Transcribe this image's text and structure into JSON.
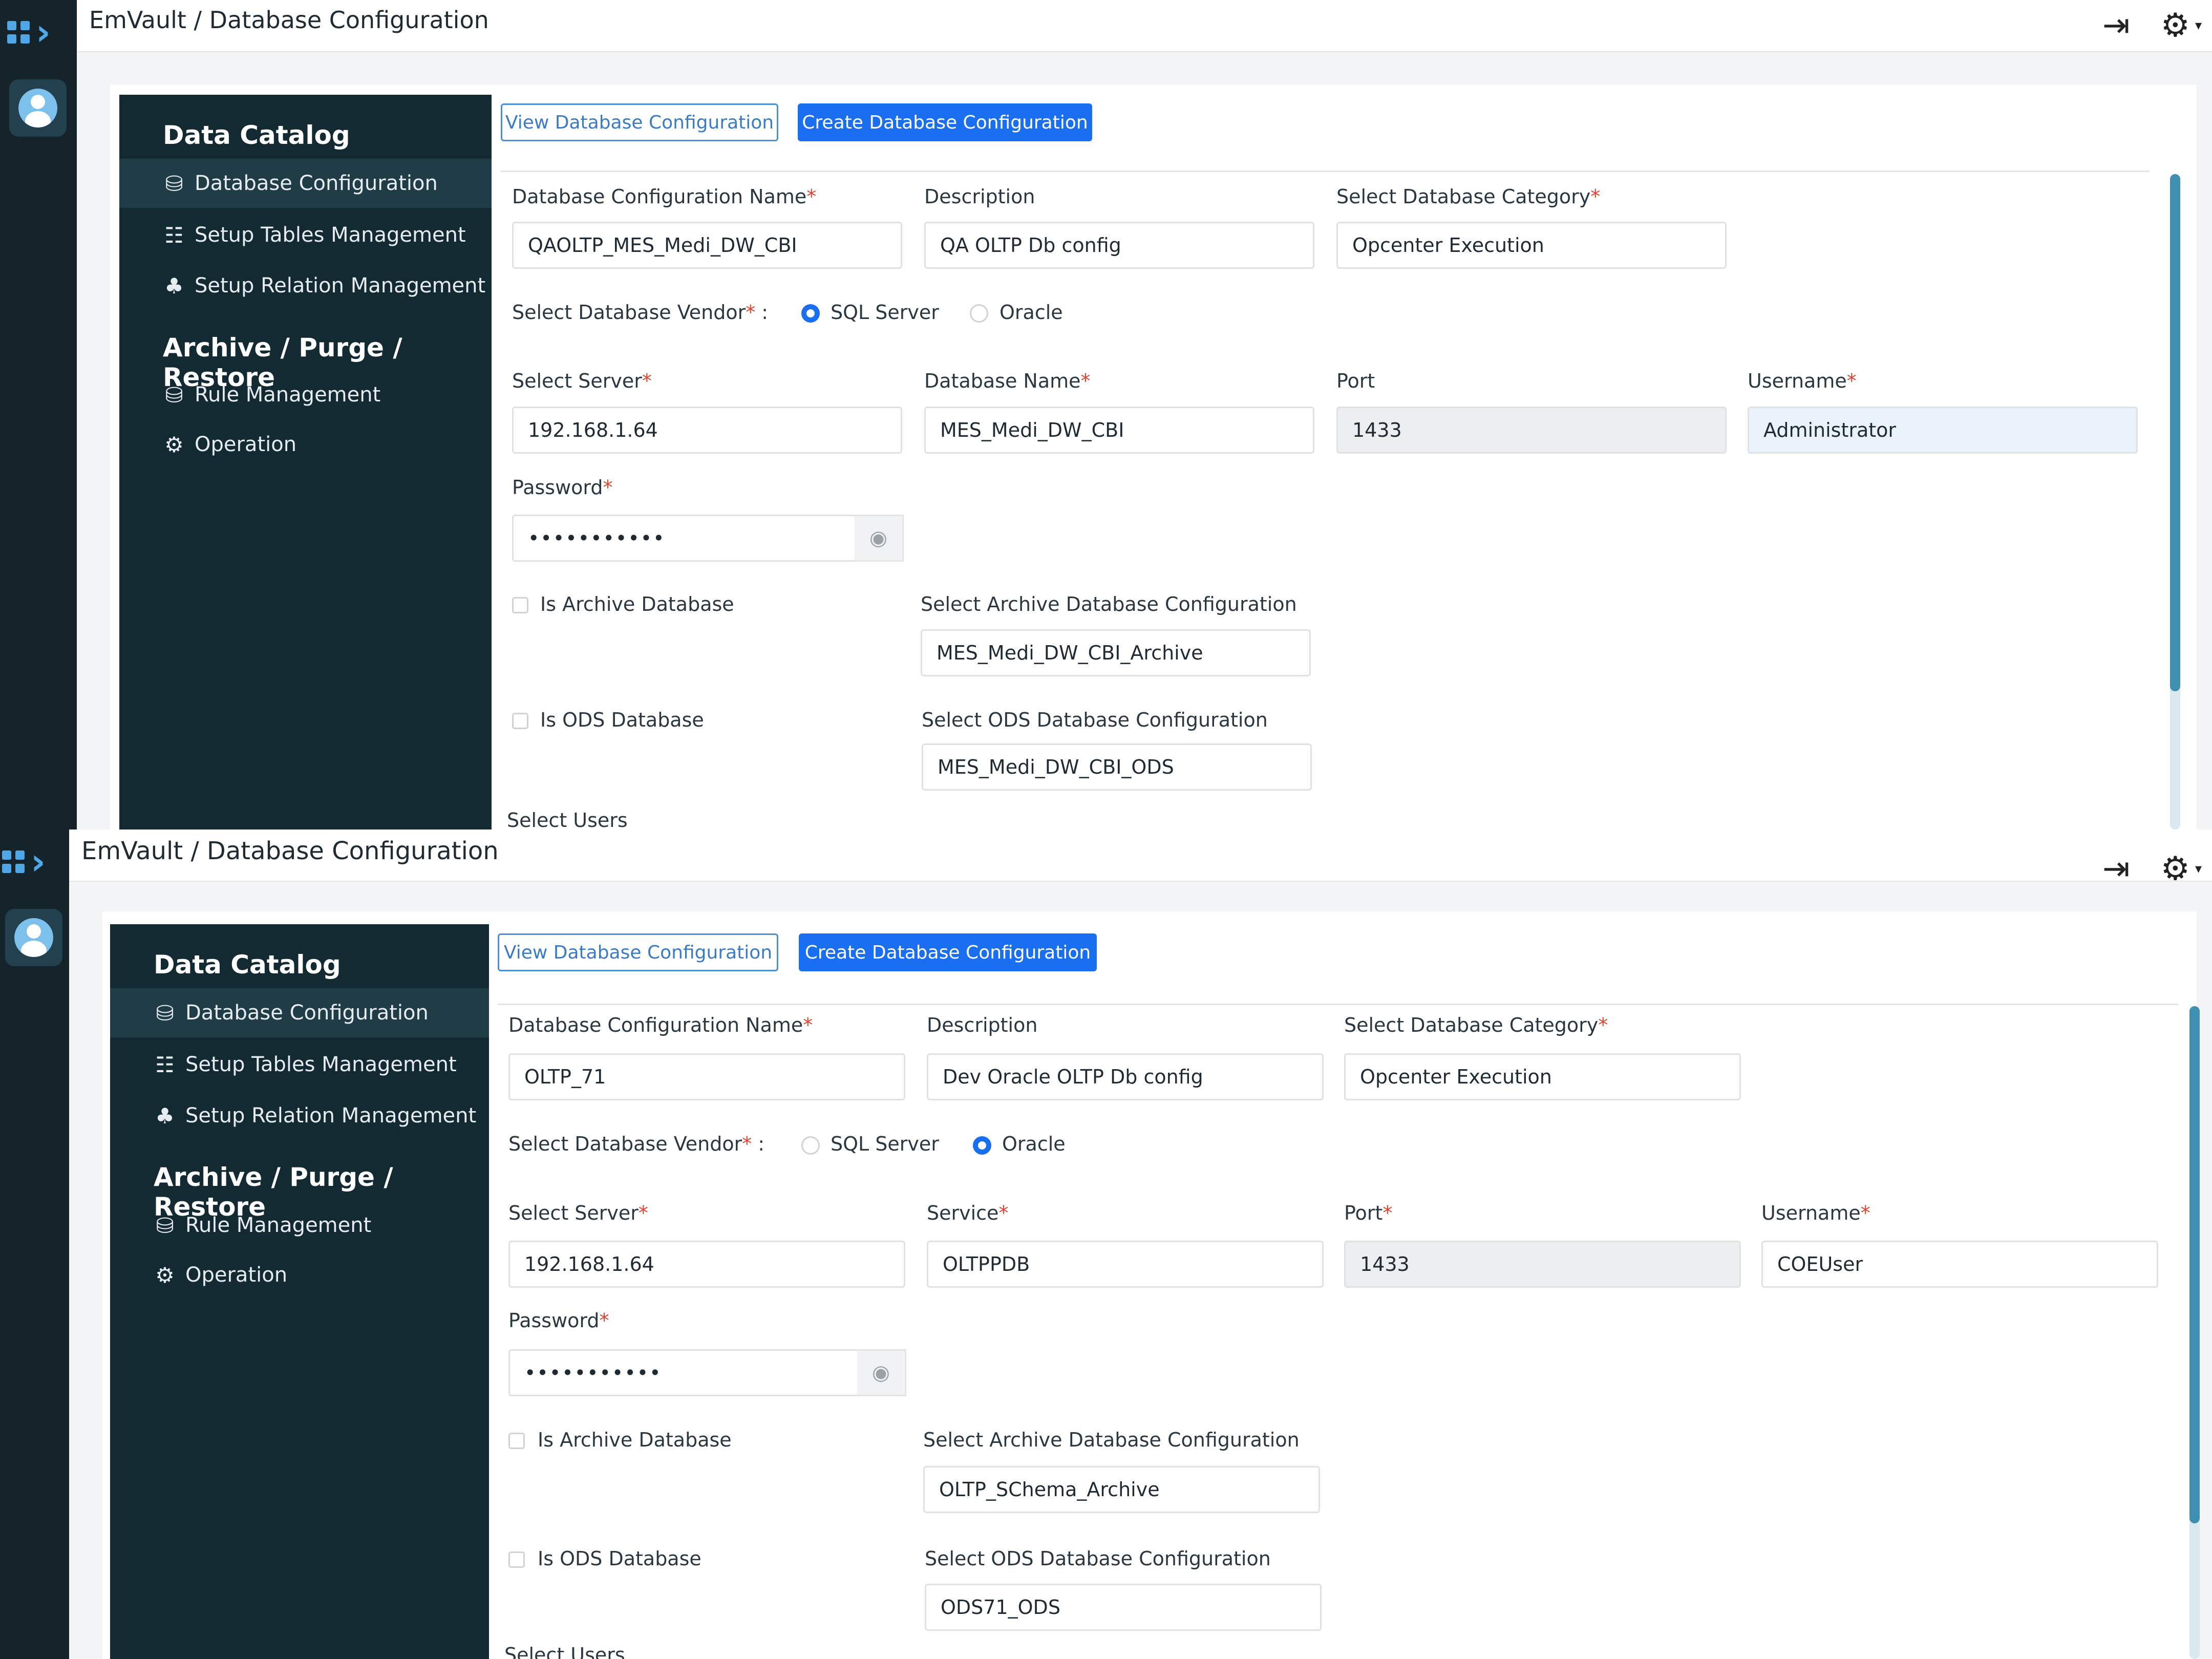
{
  "screens": [
    {
      "breadcrumb": "EmVault / Database Configuration",
      "sidebar": {
        "data_catalog_heading": "Data Catalog",
        "items_catalog": [
          "Database Configuration",
          "Setup Tables Management",
          "Setup Relation Management"
        ],
        "archive_heading": "Archive / Purge / Restore",
        "items_archive": [
          "Rule Management",
          "Operation"
        ]
      },
      "tabs": {
        "view": "View Database Configuration",
        "create": "Create Database Configuration"
      },
      "form": {
        "config_name_label": "Database Configuration Name",
        "config_name_value": "QAOLTP_MES_Medi_DW_CBI",
        "description_label": "Description",
        "description_value": "QA OLTP Db config",
        "category_label": "Select Database Category",
        "category_value": "Opcenter Execution",
        "vendor_label": "Select Database Vendor",
        "vendor_suffix": " :",
        "vendor_options": [
          "SQL Server",
          "Oracle"
        ],
        "vendor_selected": "SQL Server",
        "server_label": "Select Server",
        "server_value": "192.168.1.64",
        "dbname_label": "Database Name",
        "dbname_value": "MES_Medi_DW_CBI",
        "port_label": "Port",
        "port_value": "1433",
        "username_label": "Username",
        "username_value": "Administrator",
        "password_label": "Password",
        "password_value": "•••••••••••",
        "is_archive_label": "Is Archive Database",
        "archive_config_label": "Select Archive Database Configuration",
        "archive_config_value": "MES_Medi_DW_CBI_Archive",
        "is_ods_label": "Is ODS Database",
        "ods_config_label": "Select ODS Database Configuration",
        "ods_config_value": "MES_Medi_DW_CBI_ODS",
        "users_label": "Select Users"
      }
    },
    {
      "breadcrumb": "EmVault / Database Configuration",
      "sidebar": {
        "data_catalog_heading": "Data Catalog",
        "items_catalog": [
          "Database Configuration",
          "Setup Tables Management",
          "Setup Relation Management"
        ],
        "archive_heading": "Archive / Purge / Restore",
        "items_archive": [
          "Rule Management",
          "Operation"
        ]
      },
      "tabs": {
        "view": "View Database Configuration",
        "create": "Create Database Configuration"
      },
      "form": {
        "config_name_label": "Database Configuration Name",
        "config_name_value": "OLTP_71",
        "description_label": "Description",
        "description_value": "Dev Oracle OLTP Db config",
        "category_label": "Select Database Category",
        "category_value": "Opcenter Execution",
        "vendor_label": "Select Database Vendor",
        "vendor_suffix": " :",
        "vendor_options": [
          "SQL Server",
          "Oracle"
        ],
        "vendor_selected": "Oracle",
        "server_label": "Select Server",
        "server_value": "192.168.1.64",
        "dbname_label": "Service",
        "dbname_value": "OLTPPDB",
        "port_label": "Port",
        "port_value": "1433",
        "username_label": "Username",
        "username_value": "COEUser",
        "password_label": "Password",
        "password_value": "•••••••••••",
        "is_archive_label": "Is Archive Database",
        "archive_config_label": "Select Archive Database Configuration",
        "archive_config_value": "OLTP_SChema_Archive",
        "is_ods_label": "Is ODS Database",
        "ods_config_label": "Select ODS Database Configuration",
        "ods_config_value": "ODS71_ODS",
        "users_label": "Select Users"
      }
    }
  ]
}
